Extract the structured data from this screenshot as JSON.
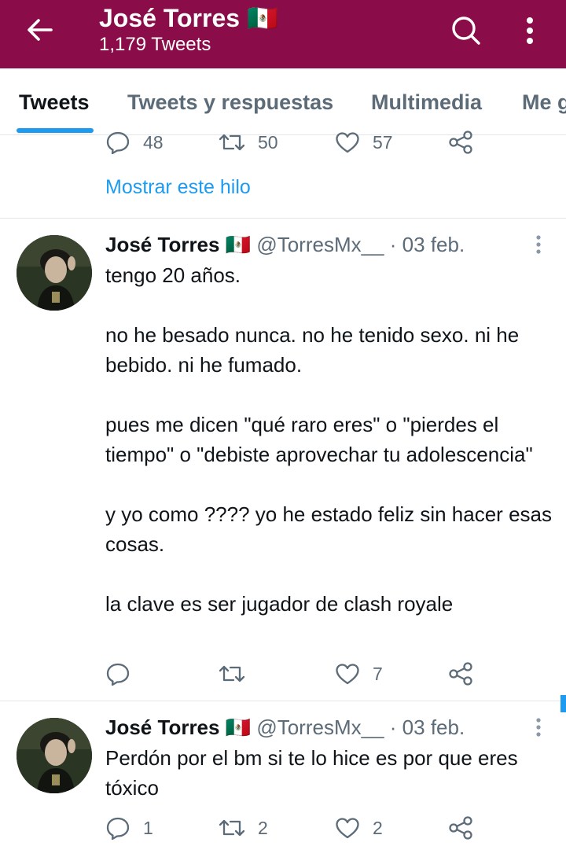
{
  "header": {
    "title": "José Torres 🇲🇽",
    "subtitle": "1,179 Tweets",
    "background": "#8a0c48"
  },
  "tabs": [
    {
      "label": "Tweets",
      "active": true
    },
    {
      "label": "Tweets y respuestas",
      "active": false
    },
    {
      "label": "Multimedia",
      "active": false
    },
    {
      "label": "Me gusta",
      "active": false
    }
  ],
  "previous_tweet": {
    "replies": "48",
    "retweets": "50",
    "likes": "57",
    "show_thread": "Mostrar este hilo"
  },
  "tweets": [
    {
      "name": "José Torres 🇲🇽",
      "handle": "@TorresMx__",
      "separator": "·",
      "date": "03 feb.",
      "text": "tengo 20 años.\n\nno he besado nunca. no he tenido sexo. ni he bebido. ni he fumado.\n\npues me dicen \"qué raro eres\" o \"pierdes el tiempo\" o \"debiste aprovechar tu adolescencia\"\n\ny yo como ???? yo he estado feliz sin hacer esas cosas.\n\nla clave es ser jugador de clash royale",
      "replies": "",
      "retweets": "",
      "likes": "7"
    },
    {
      "name": "José Torres 🇲🇽",
      "handle": "@TorresMx__",
      "separator": "·",
      "date": "03 feb.",
      "text": "Perdón por el bm si te lo hice es por que eres tóxico",
      "replies": "1",
      "retweets": "2",
      "likes": "2"
    }
  ],
  "colors": {
    "accent": "#1d9bf0",
    "muted": "#5c6b78",
    "divider": "#e3e6e9"
  },
  "icons": [
    "back-arrow-icon",
    "search-icon",
    "more-vertical-icon",
    "reply-icon",
    "retweet-icon",
    "like-icon",
    "share-icon",
    "tweet-more-icon"
  ]
}
